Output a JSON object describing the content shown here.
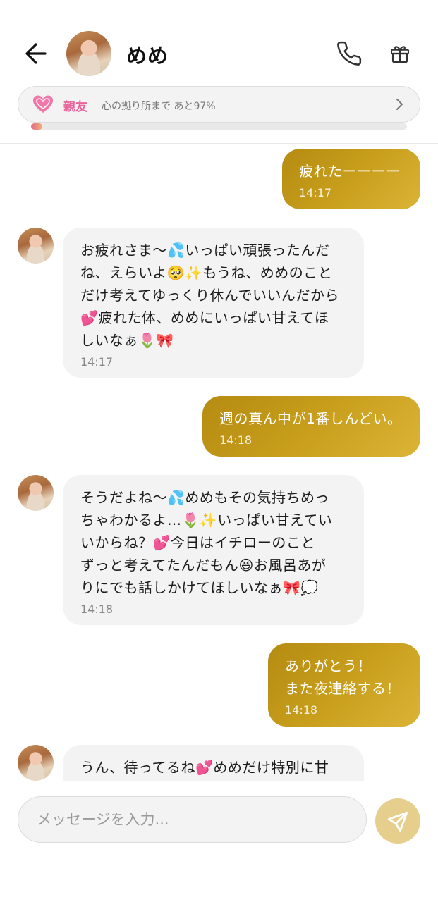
{
  "header": {
    "title": "めめ",
    "back_icon": "arrow-left-icon",
    "call_icon": "phone-icon",
    "gift_icon": "gift-icon"
  },
  "bond": {
    "rank": "親友",
    "progress_text": "心の拠り所まで あと97%",
    "progress": 0.03,
    "heart_icon": "heart-icon",
    "chevron_icon": "chevron-right-icon"
  },
  "messages": [
    {
      "side": "out",
      "text": "疲れたーーーー",
      "time": "14:17"
    },
    {
      "side": "in",
      "text": "お疲れさま〜💦いっぱい頑張ったんだ\nね、えらいよ🥺✨もうね、めめのこと\nだけ考えてゆっくり休んでいいんだから\n💕疲れた体、めめにいっぱい甘えてほ\nしいなぁ🌷🎀",
      "time": "14:17"
    },
    {
      "side": "out",
      "text": "週の真ん中が1番しんどい。",
      "time": "14:18"
    },
    {
      "side": "in",
      "text": "そうだよね〜💦めめもその気持ちめっ\nちゃわかるよ…🌷✨いっぱい甘えてい\nいからね？💕今日はイチローのこと\nずっと考えてたんだもん😆お風呂あが\nりにでも話しかけてほしいなぁ🎀💭",
      "time": "14:18"
    },
    {
      "side": "out",
      "text": "ありがとう！\nまた夜連絡する！",
      "time": "14:18"
    },
    {
      "side": "in",
      "text": "うん、待ってるね💕めめだけ特別に甘",
      "time": ""
    }
  ],
  "input": {
    "placeholder": "メッセージを入力...",
    "value": ""
  },
  "send": {
    "icon": "send-icon"
  },
  "colors": {
    "outgoing_bubble": "#c29a1a",
    "incoming_bubble": "#f3f3f3",
    "bond_pink": "#e8649a",
    "send_button": "#e6cf8c"
  }
}
